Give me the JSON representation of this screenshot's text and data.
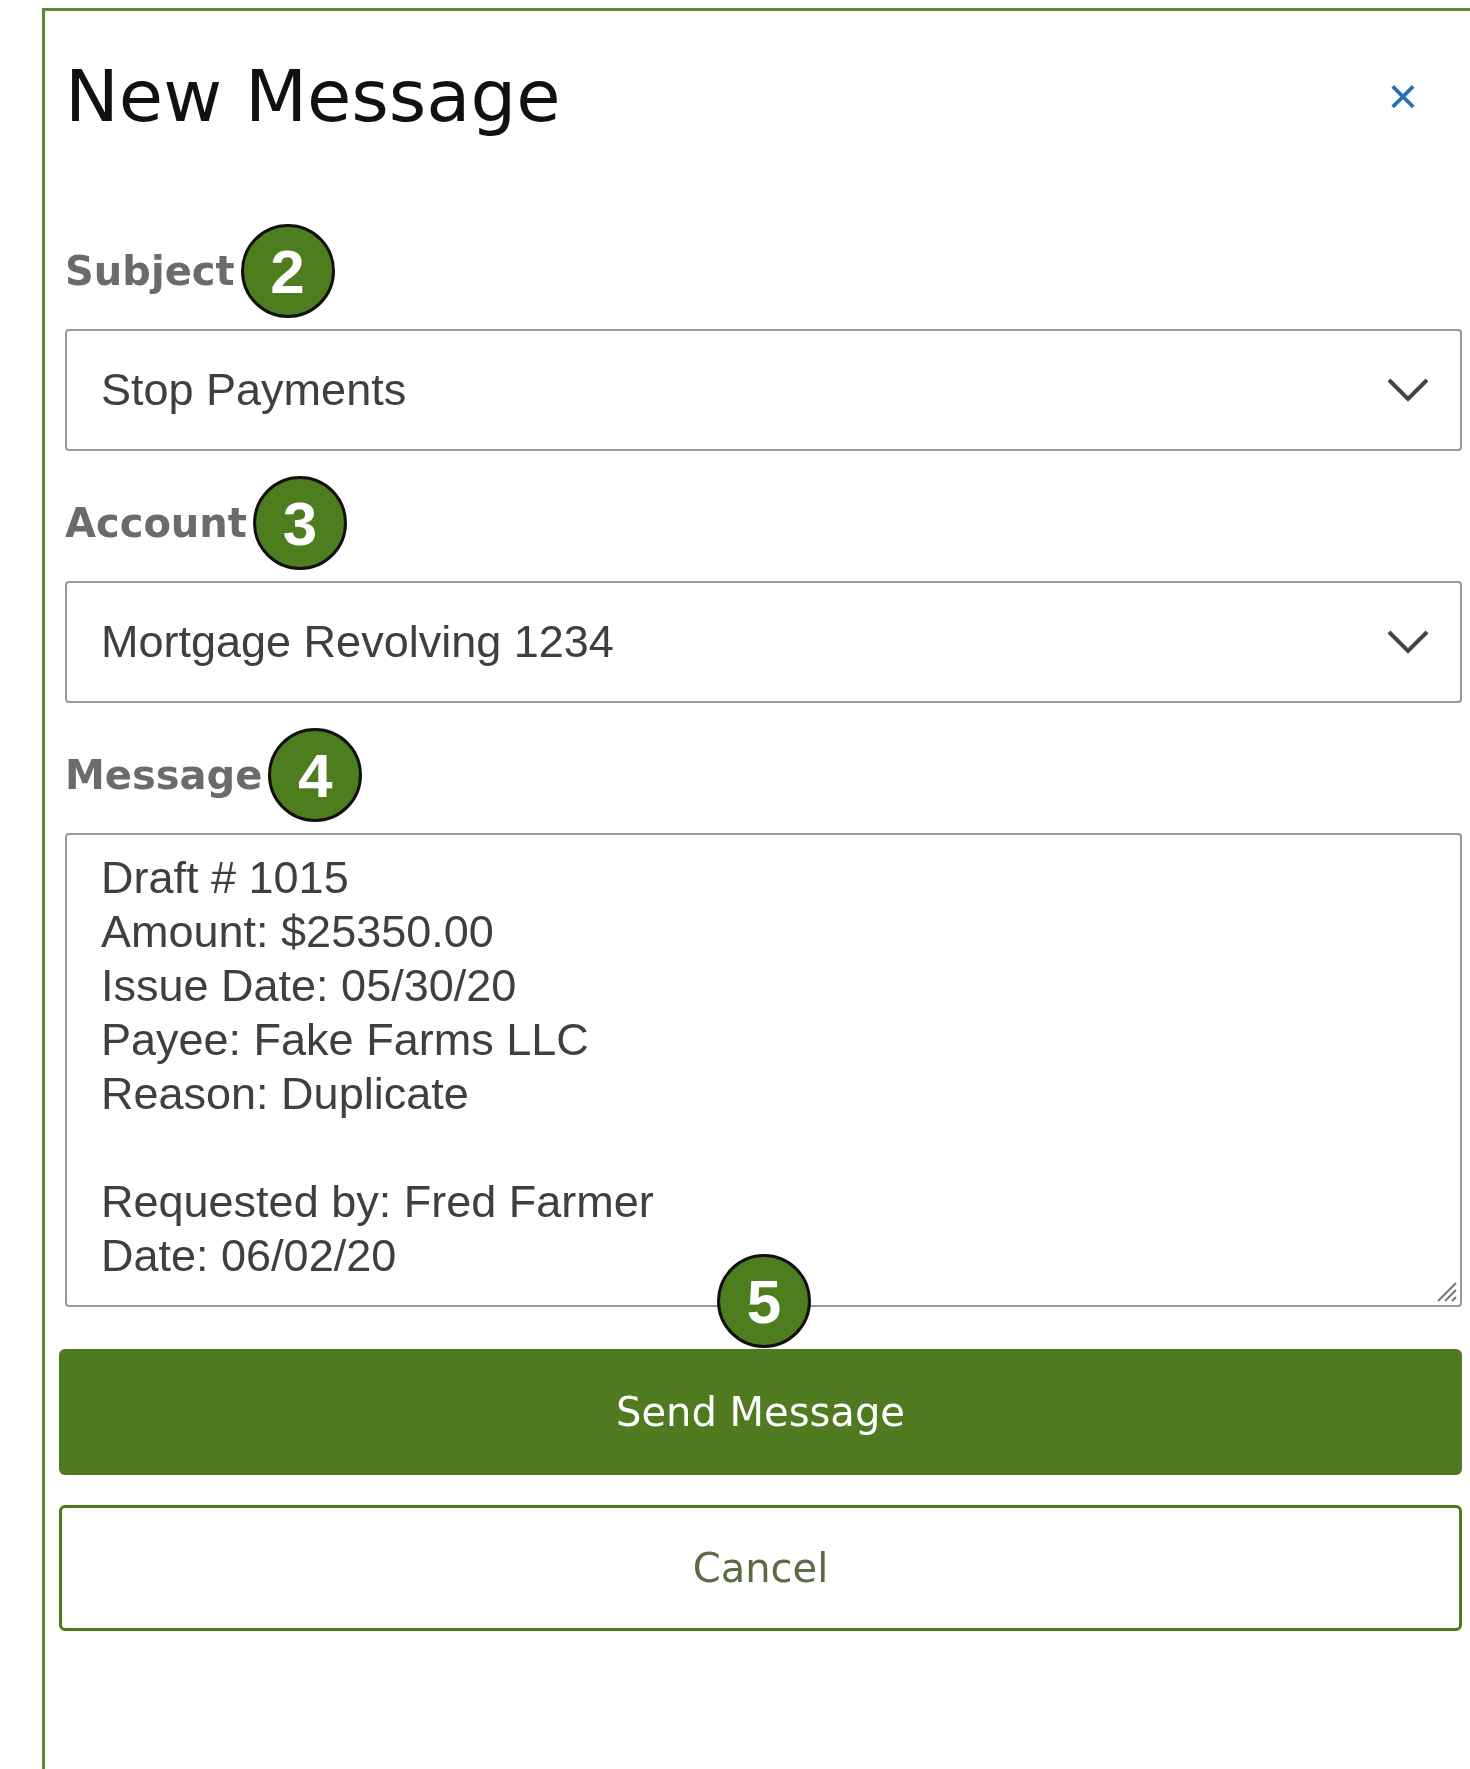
{
  "dialog": {
    "title": "New Message",
    "close": "×"
  },
  "fields": [
    {
      "kind": "select",
      "label": "Subject",
      "badge": "2",
      "value": "Stop Payments"
    },
    {
      "kind": "select",
      "label": "Account",
      "badge": "3",
      "value": "Mortgage Revolving 1234"
    },
    {
      "kind": "textarea",
      "label": "Message",
      "badge": "4",
      "value": "Draft # 1015\nAmount: $25350.00\nIssue Date: 05/30/20\nPayee: Fake Farms LLC\nReason: Duplicate\n\nRequested by: Fred Farmer\nDate: 06/02/20"
    }
  ],
  "buttons": [
    {
      "kind": "primary",
      "label": "Send Message",
      "badge": "5"
    },
    {
      "kind": "secondary",
      "label": "Cancel"
    }
  ]
}
